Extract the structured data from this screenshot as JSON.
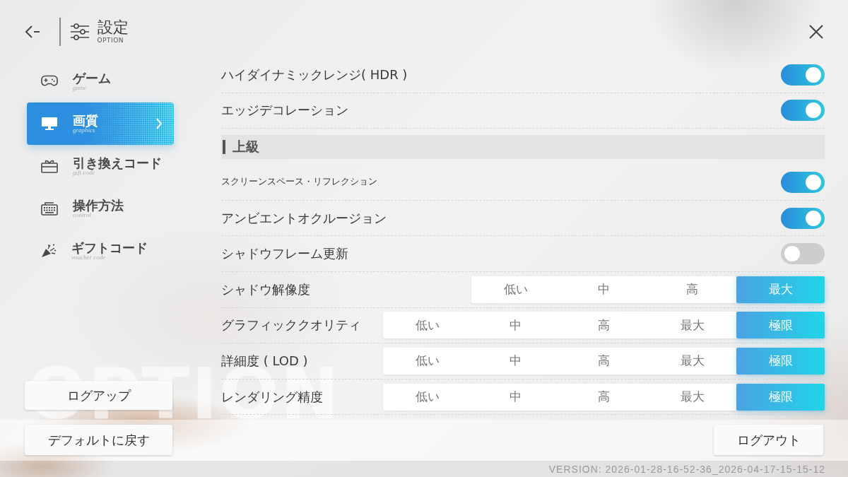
{
  "header": {
    "title": "設定",
    "subtitle": "OPTION"
  },
  "sidebar": {
    "items": [
      {
        "label": "ゲーム",
        "sublabel": "game",
        "selected": false
      },
      {
        "label": "画質",
        "sublabel": "graphics",
        "selected": true
      },
      {
        "label": "引き換えコード",
        "sublabel": "gift code",
        "selected": false
      },
      {
        "label": "操作方法",
        "sublabel": "control",
        "selected": false
      },
      {
        "label": "ギフトコード",
        "sublabel": "voucher code",
        "selected": false
      }
    ],
    "button": "ログアップ"
  },
  "backdrop_text": "OPTION",
  "settings": [
    {
      "kind": "toggle",
      "label": "ハイダイナミックレンジ( HDR )",
      "on": true,
      "small_label": false
    },
    {
      "kind": "toggle",
      "label": "エッジデコレーション",
      "on": true,
      "small_label": false
    },
    {
      "kind": "section",
      "label": "上級"
    },
    {
      "kind": "toggle",
      "label": "スクリーンスペース・リフレクション",
      "on": true,
      "small_label": true
    },
    {
      "kind": "toggle",
      "label": "アンビエントオクルージョン",
      "on": true,
      "small_label": false
    },
    {
      "kind": "toggle",
      "label": "シャドウフレーム更新",
      "on": false,
      "small_label": false
    },
    {
      "kind": "choice",
      "label": "シャドウ解像度",
      "options": [
        {
          "label": "低い",
          "selected": false
        },
        {
          "label": "中",
          "selected": false
        },
        {
          "label": "高",
          "selected": false
        },
        {
          "label": "最大",
          "selected": true
        }
      ]
    },
    {
      "kind": "choice",
      "label": "グラフィッククオリティ",
      "options": [
        {
          "label": "低い",
          "selected": false
        },
        {
          "label": "中",
          "selected": false
        },
        {
          "label": "高",
          "selected": false
        },
        {
          "label": "最大",
          "selected": false
        },
        {
          "label": "極限",
          "selected": true
        }
      ]
    },
    {
      "kind": "choice",
      "label": "詳細度 ( LOD )",
      "options": [
        {
          "label": "低い",
          "selected": false
        },
        {
          "label": "中",
          "selected": false
        },
        {
          "label": "高",
          "selected": false
        },
        {
          "label": "最大",
          "selected": false
        },
        {
          "label": "極限",
          "selected": true
        }
      ]
    },
    {
      "kind": "choice",
      "label": "レンダリング精度",
      "options": [
        {
          "label": "低い",
          "selected": false
        },
        {
          "label": "中",
          "selected": false
        },
        {
          "label": "高",
          "selected": false
        },
        {
          "label": "最大",
          "selected": false
        },
        {
          "label": "極限",
          "selected": true
        }
      ]
    }
  ],
  "footer": {
    "reset_button": "デフォルトに戻す",
    "logout_button": "ログアウト",
    "version": "VERSION: 2026-01-28-16-52-36_2026-04-17-15-15-12"
  }
}
